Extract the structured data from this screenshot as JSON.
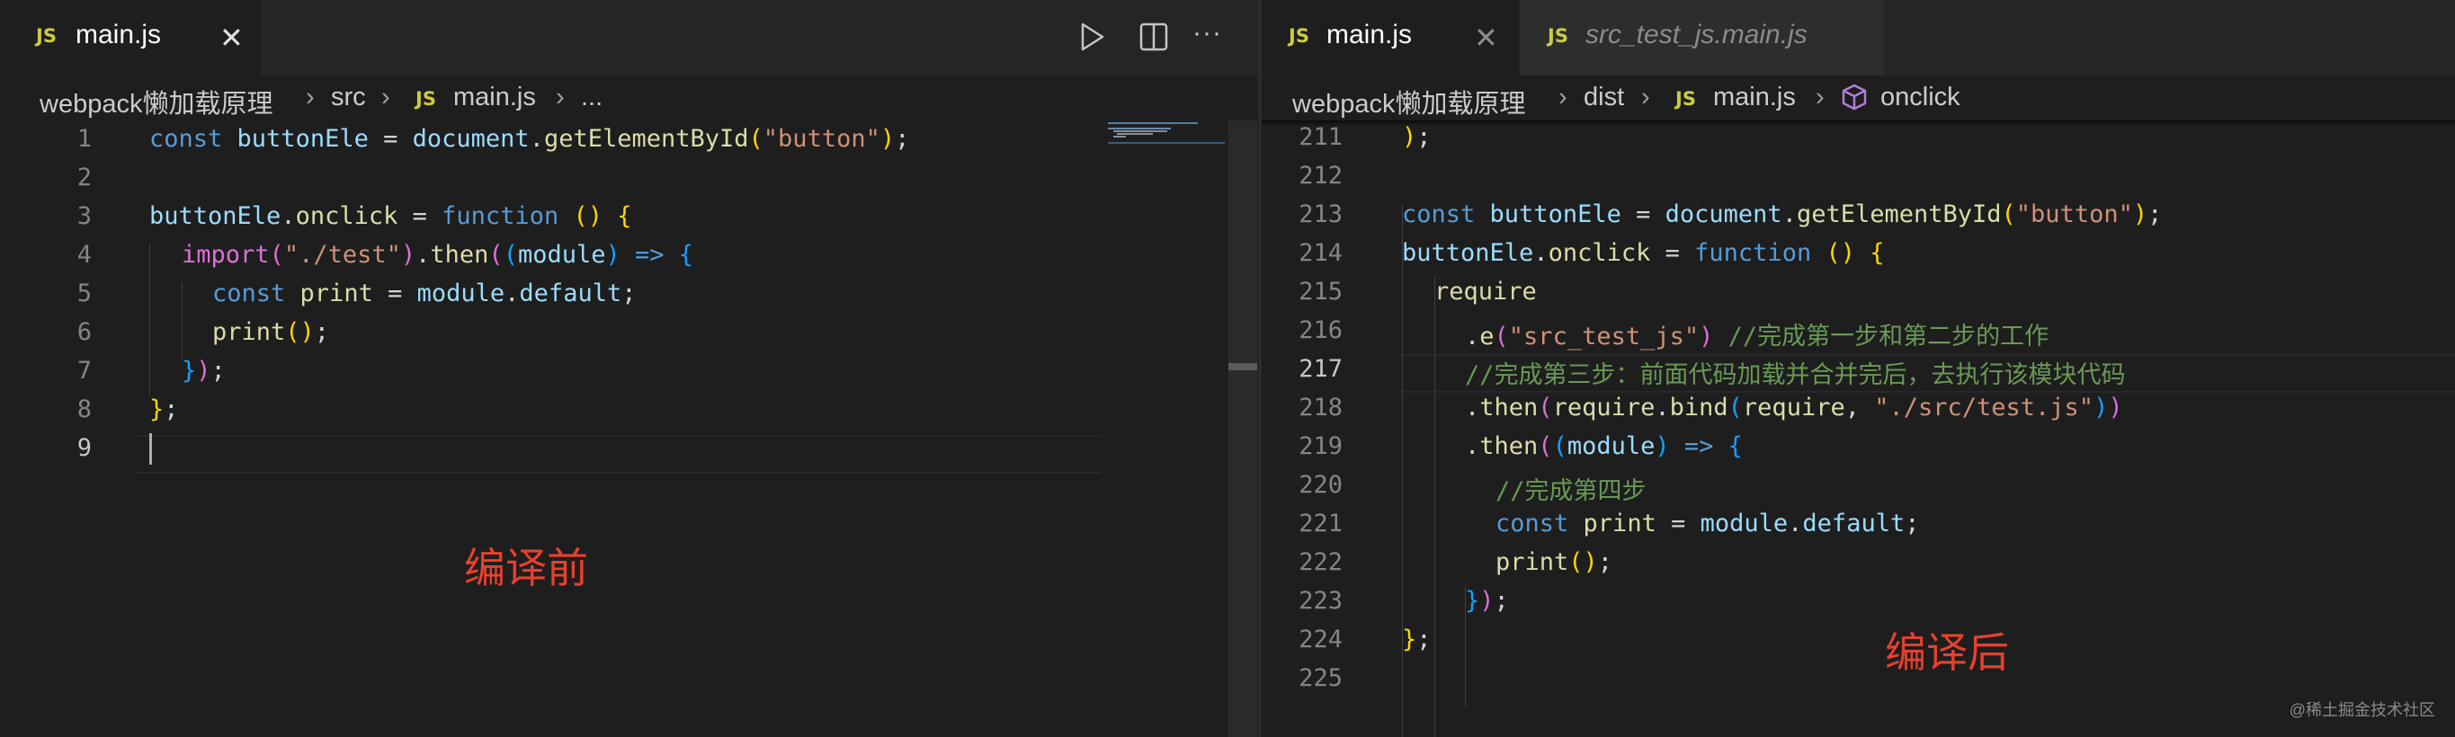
{
  "left": {
    "tab": {
      "badge": "JS",
      "label": "main.js",
      "close": "✕"
    },
    "toolbar": {
      "run": "run-icon",
      "split": "split-editor-icon",
      "more": "···"
    },
    "breadcrumb": [
      {
        "label": "webpack懒加载原理"
      },
      {
        "label": "src"
      },
      {
        "badge": "JS",
        "label": "main.js"
      },
      {
        "label": "..."
      }
    ],
    "line_numbers": [
      "1",
      "2",
      "3",
      "4",
      "5",
      "6",
      "7",
      "8",
      "9"
    ],
    "current_line": "9",
    "annotation": "编译前"
  },
  "right": {
    "tabs": [
      {
        "badge": "JS",
        "label": "main.js",
        "close": "✕"
      },
      {
        "badge": "JS",
        "label": "src_test_js.main.js"
      }
    ],
    "breadcrumb": [
      {
        "label": "webpack懒加载原理"
      },
      {
        "label": "dist"
      },
      {
        "badge": "JS",
        "label": "main.js"
      },
      {
        "label": "onclick",
        "icon": "method-cube-icon"
      }
    ],
    "line_numbers": [
      "211",
      "212",
      "213",
      "214",
      "215",
      "216",
      "217",
      "218",
      "219",
      "220",
      "221",
      "222",
      "223",
      "224",
      "225"
    ],
    "current_line": "217",
    "annotation": "编译后"
  },
  "code": {
    "buttonEle": "buttonEle",
    "document": "document",
    "getElementById": "getElementById",
    "button_str": "\"button\"",
    "onclick": "onclick",
    "import": "import",
    "test_str": "\"./test\"",
    "then": "then",
    "module": "module",
    "print": "print",
    "default": "default",
    "require": "require",
    "e": "e",
    "src_test_js_str": "\"src_test_js\"",
    "comment_216": "//完成第一步和第二步的工作",
    "comment_217": "//完成第三步：前面代码加载并合并完后，去执行该模块代码",
    "bind": "bind",
    "src_test_path_str": "\"./src/test.js\"",
    "comment_220": "//完成第四步"
  },
  "watermark": "@稀土掘金技术社区",
  "colors": {
    "accent_annotation": "#e8402e",
    "editor_bg": "#1e1e1e",
    "js_badge": "#cbcb41"
  }
}
